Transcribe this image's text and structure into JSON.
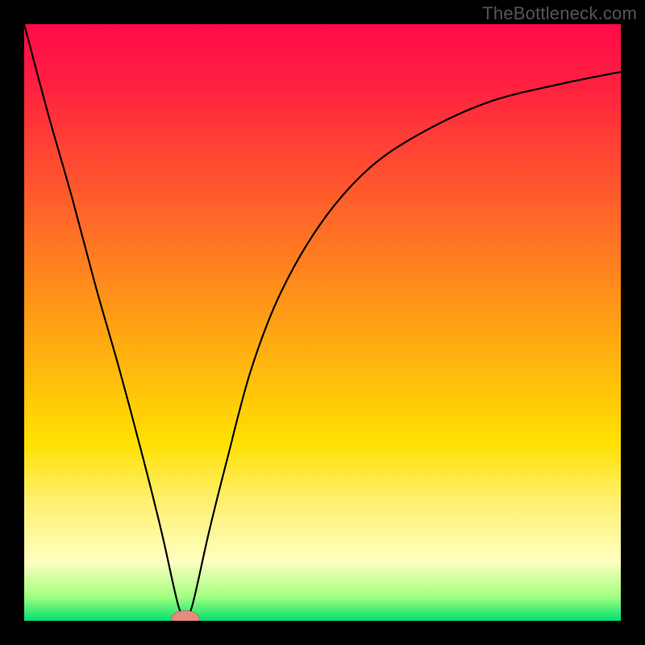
{
  "watermark": "TheBottleneck.com",
  "colors": {
    "frame": "#000000",
    "gradient_stops": [
      {
        "offset": 0.0,
        "color": "#ff0a4a"
      },
      {
        "offset": 0.1,
        "color": "#ff2040"
      },
      {
        "offset": 0.25,
        "color": "#ff5030"
      },
      {
        "offset": 0.4,
        "color": "#ff8020"
      },
      {
        "offset": 0.55,
        "color": "#ffb010"
      },
      {
        "offset": 0.7,
        "color": "#ffe000"
      },
      {
        "offset": 0.8,
        "color": "#fff070"
      },
      {
        "offset": 0.9,
        "color": "#ffffc0"
      },
      {
        "offset": 0.96,
        "color": "#a0ff80"
      },
      {
        "offset": 1.0,
        "color": "#00e070"
      }
    ],
    "curve": "#000000",
    "marker_fill": "#e58a80",
    "marker_stroke": "#c86a60"
  },
  "chart_data": {
    "type": "line",
    "title": "",
    "xlabel": "",
    "ylabel": "",
    "x_range": [
      0,
      100
    ],
    "y_range": [
      0,
      100
    ],
    "note": "V-shaped bottleneck curve. y ≈ 100 means maximum bottleneck (red), y ≈ 0 means balanced (green). Minimum around x ≈ 27.",
    "series": [
      {
        "name": "bottleneck_curve",
        "x": [
          0,
          4,
          8,
          12,
          16,
          20,
          23,
          25,
          26,
          27,
          28,
          29,
          31,
          34,
          38,
          43,
          50,
          58,
          67,
          78,
          90,
          100
        ],
        "y": [
          100,
          85,
          71,
          56,
          42,
          27,
          15,
          6,
          2,
          0,
          2,
          6,
          15,
          27,
          42,
          55,
          67,
          76,
          82,
          87,
          90,
          92
        ]
      }
    ],
    "marker": {
      "x": 27,
      "y": 0,
      "rx": 2.3,
      "ry": 1.3
    }
  }
}
